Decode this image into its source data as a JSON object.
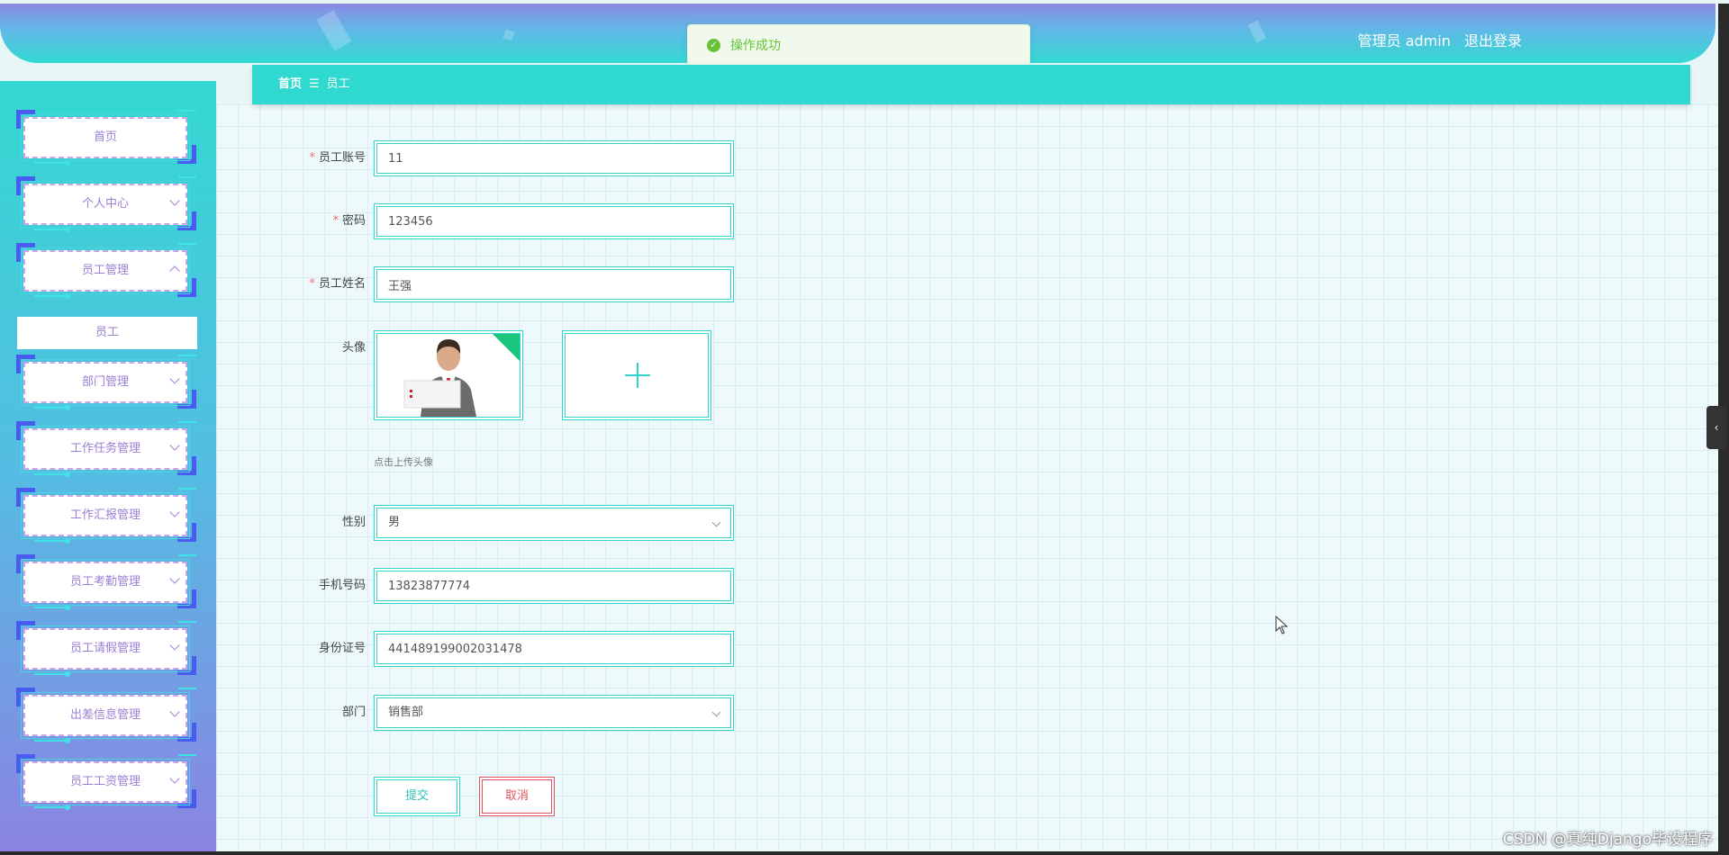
{
  "header": {
    "user_label": "管理员 admin",
    "logout_label": "退出登录"
  },
  "toast": {
    "message": "操作成功",
    "icon": "check-circle-icon",
    "color": "#67c23a"
  },
  "sidebar": {
    "items": [
      {
        "label": "首页",
        "chevron": "none"
      },
      {
        "label": "个人中心",
        "chevron": "down"
      },
      {
        "label": "员工管理",
        "chevron": "up"
      },
      {
        "label": "部门管理",
        "chevron": "down"
      },
      {
        "label": "工作任务管理",
        "chevron": "down"
      },
      {
        "label": "工作汇报管理",
        "chevron": "down"
      },
      {
        "label": "员工考勤管理",
        "chevron": "down"
      },
      {
        "label": "员工请假管理",
        "chevron": "down"
      },
      {
        "label": "出差信息管理",
        "chevron": "down"
      },
      {
        "label": "员工工资管理",
        "chevron": "down"
      }
    ],
    "active_submenu": "员工"
  },
  "breadcrumb": {
    "home": "首页",
    "separator": "☰",
    "current": "员工"
  },
  "form": {
    "account": {
      "label": "员工账号",
      "value": "11",
      "required": true
    },
    "password": {
      "label": "密码",
      "value": "123456",
      "required": true
    },
    "name": {
      "label": "员工姓名",
      "value": "王强",
      "required": true
    },
    "avatar": {
      "label": "头像",
      "hint": "点击上传头像"
    },
    "gender": {
      "label": "性别",
      "value": "男"
    },
    "phone": {
      "label": "手机号码",
      "value": "13823877774"
    },
    "id_number": {
      "label": "身份证号",
      "value": "441489199002031478"
    },
    "department": {
      "label": "部门",
      "value": "销售部"
    },
    "required_mark": "*"
  },
  "buttons": {
    "submit": "提交",
    "cancel": "取消"
  },
  "collapse_toggle": "‹",
  "watermark": "CSDN @真纯Django毕设程序",
  "colors": {
    "accent": "#2fd4cc",
    "sidebar_text": "#9a7fd6",
    "cancel": "#e0535c"
  }
}
